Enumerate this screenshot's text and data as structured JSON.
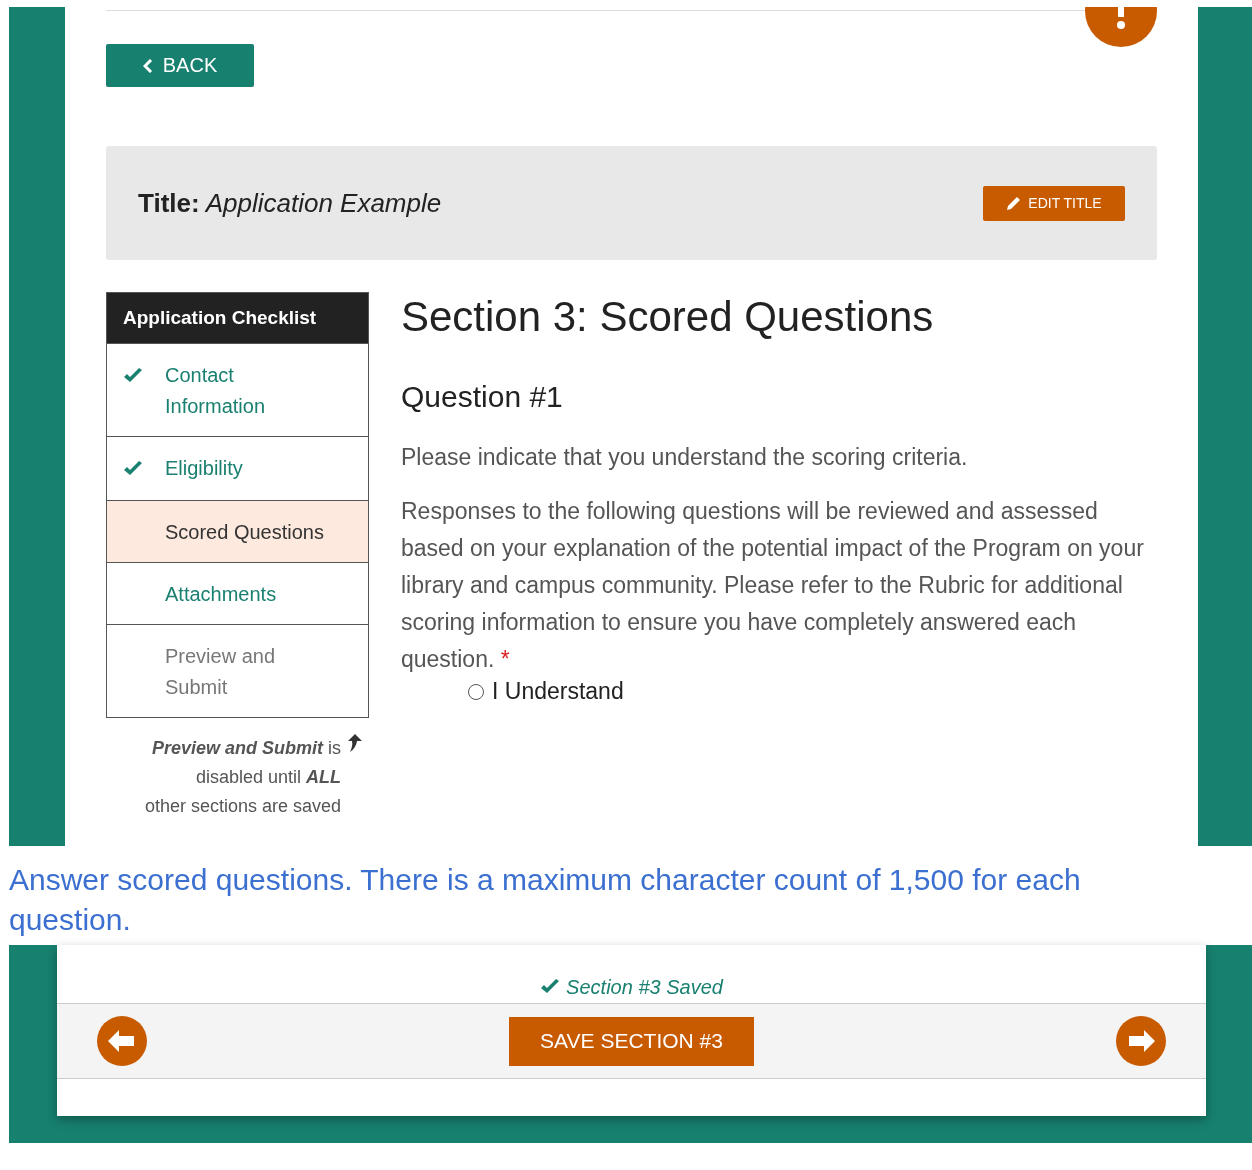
{
  "top_panel": {
    "back_button": "BACK",
    "title_bar": {
      "label": "Title:",
      "value": "Application Example",
      "edit_button": "EDIT TITLE"
    },
    "checklist": {
      "header": "Application Checklist",
      "items": [
        {
          "label": "Contact\nInformation",
          "checked": true,
          "selected": false,
          "disabled": false
        },
        {
          "label": "Eligibility",
          "checked": true,
          "selected": false,
          "disabled": false
        },
        {
          "label": "Scored Questions",
          "checked": false,
          "selected": true,
          "disabled": false
        },
        {
          "label": "Attachments",
          "checked": false,
          "selected": false,
          "disabled": false
        },
        {
          "label": "Preview and\nSubmit",
          "checked": false,
          "selected": false,
          "disabled": true
        }
      ]
    },
    "footnote": "**Preview and Submit** is\ndisabled until **ALL**\nother sections are saved",
    "section": {
      "heading": "Section 3: Scored Questions",
      "question_title": "Question #1",
      "prompt": "Please indicate that you understand the scoring criteria.",
      "description": "Responses to the following questions will be reviewed and assessed based on your explanation of the potential impact of the Program on your library and campus community. Please refer to the Rubric for additional scoring information to ensure you have completely answered each question.",
      "required_mark": "*",
      "options": [
        {
          "label": "I Understand",
          "selected": false
        }
      ]
    }
  },
  "caption": "Answer scored questions. There is a maximum character count of 1,500 for each question.",
  "bottom_panel": {
    "status": "Section #3 Saved",
    "save_button": "SAVE SECTION #3"
  }
}
